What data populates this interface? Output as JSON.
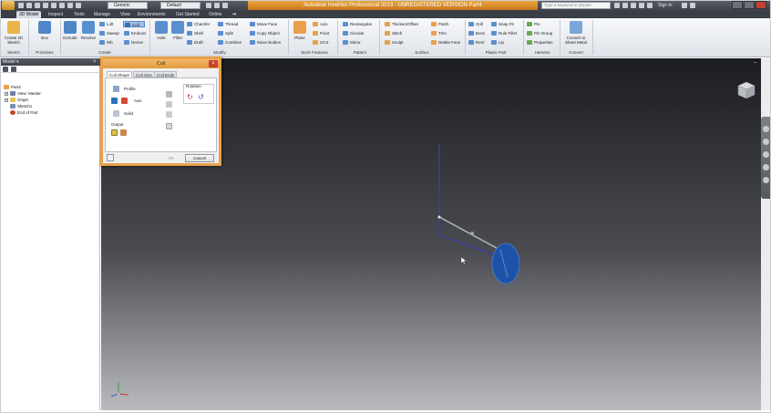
{
  "titlebar": {
    "document_title": "Autodesk Inventor Professional 2013 - UNREGISTERED VERSION   Part4",
    "appearance_dropdown": "Generic",
    "material_dropdown": "Default",
    "help_search_placeholder": "Type a keyword or phrase",
    "signin_label": "Sign In"
  },
  "ribbon_tabs": [
    "3D Model",
    "Inspect",
    "Tools",
    "Manage",
    "View",
    "Environments",
    "Get Started",
    "Online"
  ],
  "ribbon": {
    "sketch": {
      "create_2d_sketch": "Create 2D Sketch",
      "title": "Sketch"
    },
    "primitives": {
      "box": "Box",
      "title": "Primitives"
    },
    "create": {
      "extrude": "Extrude",
      "revolve": "Revolve",
      "loft": "Loft",
      "coil": "Coil",
      "sweep": "Sweep",
      "emboss": "Emboss",
      "rib": "Rib",
      "derive": "Derive",
      "title": "Create"
    },
    "modify": {
      "hole": "Hole",
      "fillet": "Fillet",
      "chamfer": "Chamfer",
      "thread": "Thread",
      "move_face": "Move Face",
      "shell": "Shell",
      "split": "Split",
      "copy_object": "Copy Object",
      "draft": "Draft",
      "combine": "Combine",
      "move_bodies": "Move Bodies",
      "title": "Modify"
    },
    "work_features": {
      "plane": "Plane",
      "axis": "Axis",
      "point": "Point",
      "ucs": "UCS",
      "title": "Work Features"
    },
    "pattern": {
      "rectangular": "Rectangular",
      "circular": "Circular",
      "mirror": "Mirror",
      "title": "Pattern"
    },
    "surface": {
      "thicken_offset": "Thicken/Offset",
      "patch": "Patch",
      "stitch": "Stitch",
      "trim": "Trim",
      "sculpt": "Sculpt",
      "delete_face": "Delete Face",
      "title": "Surface"
    },
    "plastic_part": {
      "grill": "Grill",
      "snap_fit": "Snap Fit",
      "boss": "Boss",
      "rule_fillet": "Rule Fillet",
      "rest": "Rest",
      "lip": "Lip",
      "title": "Plastic Part"
    },
    "harness": {
      "pin": "Pin",
      "pin_group": "Pin Group",
      "properties": "Properties",
      "title": "Harness"
    },
    "convert": {
      "convert_to_sheet_metal": "Convert to Sheet Metal",
      "title": "Convert"
    }
  },
  "browser": {
    "header": "Model",
    "tree": [
      {
        "label": "Part4",
        "icon": "part-icon"
      },
      {
        "label": "View: Master",
        "icon": "view-icon"
      },
      {
        "label": "Origin",
        "icon": "folder-icon"
      },
      {
        "label": "Sketch1",
        "icon": "sketch-icon"
      },
      {
        "label": "End of Part",
        "icon": "end-of-part-icon"
      }
    ]
  },
  "coil_dialog": {
    "title": "Coil",
    "tabs": [
      "Coil Shape",
      "Coil Size",
      "Coil Ends"
    ],
    "profile_label": "Profile",
    "axis_label": "Axis",
    "solid_label": "Solid",
    "output_label": "Output",
    "rotation_label": "Rotation",
    "ok_label": "OK",
    "cancel_label": "Cancel"
  },
  "colors": {
    "accent_orange": "#e8a14a",
    "viewport_top": "#1c1d20",
    "viewport_bottom": "#b9bbbf",
    "profile_blue": "#1e52a8",
    "axis_line": "#3b3f9a"
  }
}
